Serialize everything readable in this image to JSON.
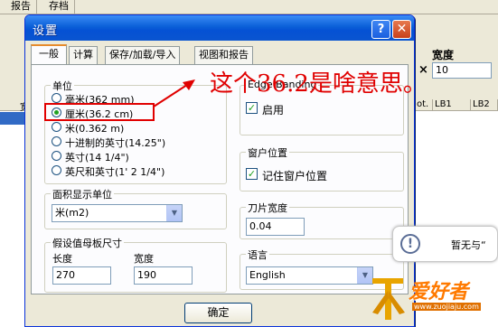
{
  "app": {
    "tabs": [
      "报告",
      "存档"
    ],
    "right_panel": {
      "width_label": "宽度",
      "width_value": "10",
      "close_symbol": "×"
    },
    "grid_headers": {
      "left": "宽",
      "c1": "ot.",
      "c2": "LB1",
      "c3": "LB2"
    }
  },
  "dialog": {
    "title": "设置",
    "help_symbol": "?",
    "close_symbol": "✕",
    "tabs": [
      "一般",
      "计算",
      "保存/加载/导入",
      "视图和报告"
    ],
    "unit_group": {
      "label": "单位",
      "options": [
        "毫米(362 mm)",
        "厘米(36.2 cm)",
        "米(0.362 m)",
        "十进制的英寸(14.25\")",
        "英寸(14 1/4\")",
        "英尺和英寸(1' 2 1/4\")"
      ],
      "selected_index": 1
    },
    "area_group": {
      "label": "面积显示单位",
      "value": "米(m2)"
    },
    "default_board_group": {
      "label": "假设值母板尺寸",
      "length_label": "长度",
      "length_value": "270",
      "width_label": "宽度",
      "width_value": "190"
    },
    "edge_banding_group": {
      "label": "Edge Banding",
      "checkbox_label": "启用",
      "checked": true
    },
    "window_pos_group": {
      "label": "窗户位置",
      "checkbox_label": "记住窗户位置",
      "checked": true
    },
    "blade_group": {
      "label": "刀片宽度",
      "value": "0.04"
    },
    "language_group": {
      "label": "语言",
      "value": "English"
    },
    "ok_button": "确定"
  },
  "annotation": {
    "text": "这个36.2是啥意思。",
    "color": "#e00000"
  },
  "toast": {
    "icon": "!",
    "text": "暂无与“"
  },
  "watermark": {
    "text": "爱好者",
    "url": "www.zuojiaju.com"
  }
}
